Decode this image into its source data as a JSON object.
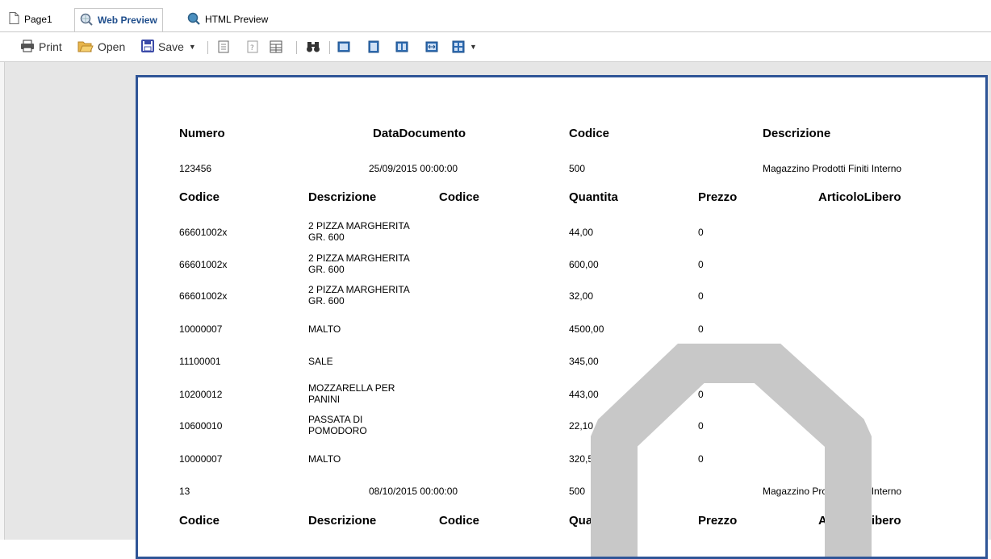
{
  "tabs": [
    {
      "label": "Page1",
      "icon": "document-icon"
    },
    {
      "label": "Web Preview",
      "icon": "web-preview-icon"
    },
    {
      "label": "HTML Preview",
      "icon": "html-preview-icon"
    }
  ],
  "toolbar": {
    "print_label": "Print",
    "open_label": "Open",
    "save_label": "Save"
  },
  "report": {
    "doc_header": {
      "numero": "Numero",
      "data": "DataDocumento",
      "codice": "Codice",
      "descrizione": "Descrizione"
    },
    "doc1": {
      "numero": "123456",
      "data": "25/09/2015 00:00:00",
      "codice": "500",
      "descrizione": "Magazzino Prodotti Finiti Interno"
    },
    "line_header": {
      "codice": "Codice",
      "descrizione": "Descrizione",
      "codice2": "Codice",
      "quantita": "Quantita",
      "prezzo": "Prezzo",
      "articolo": "ArticoloLibero"
    },
    "rows": [
      {
        "codice": "66601002x",
        "desc1": "2 PIZZA MARGHERITA",
        "desc2": "GR. 600",
        "quantita": "44,00",
        "prezzo": "0"
      },
      {
        "codice": "66601002x",
        "desc1": "2 PIZZA MARGHERITA",
        "desc2": "GR. 600",
        "quantita": "600,00",
        "prezzo": "0"
      },
      {
        "codice": "66601002x",
        "desc1": "2 PIZZA MARGHERITA",
        "desc2": "GR. 600",
        "quantita": "32,00",
        "prezzo": "0"
      },
      {
        "codice": "10000007",
        "desc1": "MALTO",
        "desc2": "",
        "quantita": "4500,00",
        "prezzo": "0"
      },
      {
        "codice": "11100001",
        "desc1": "SALE",
        "desc2": "",
        "quantita": "345,00",
        "prezzo": "0"
      },
      {
        "codice": "10200012",
        "desc1": "MOZZARELLA PER",
        "desc2": "PANINI",
        "quantita": "443,00",
        "prezzo": "0"
      },
      {
        "codice": "10600010",
        "desc1": "PASSATA DI",
        "desc2": "POMODORO",
        "quantita": "22,10",
        "prezzo": "0"
      },
      {
        "codice": "10000007",
        "desc1": "MALTO",
        "desc2": "",
        "quantita": "320,50",
        "prezzo": "0"
      }
    ],
    "doc2": {
      "numero": "13",
      "data": "08/10/2015 00:00:00",
      "codice": "500",
      "descrizione": "Magazzino Prodotti Finiti Interno"
    }
  },
  "colors": {
    "accent": "#2f5597",
    "watermark": "#c8c8c8"
  }
}
